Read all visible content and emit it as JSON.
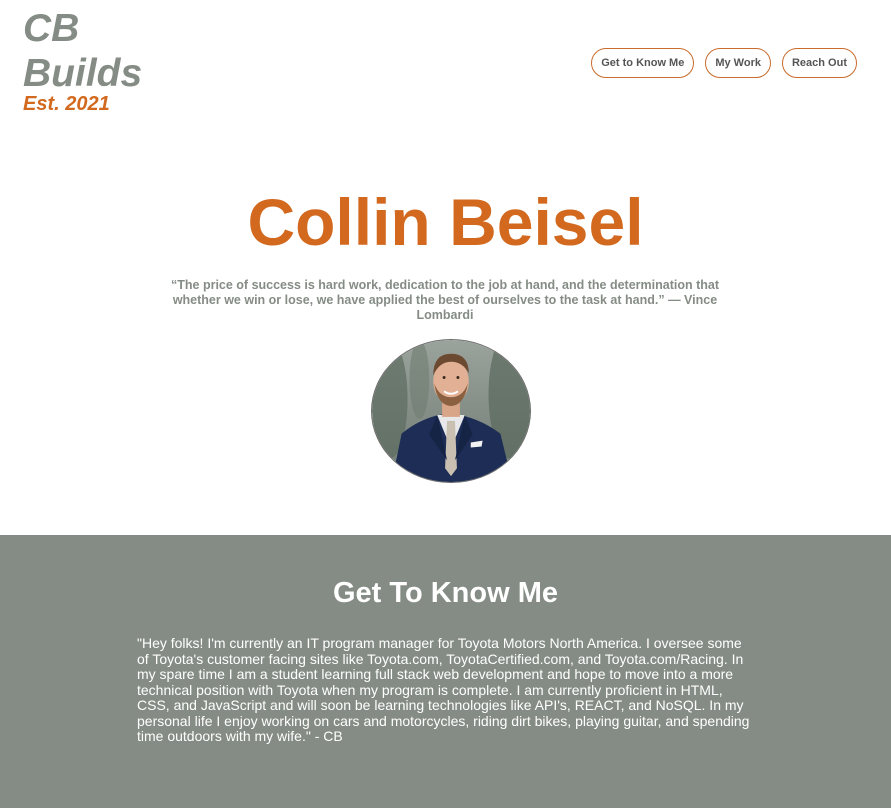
{
  "header": {
    "logo_line1": "CB",
    "logo_line2": "Builds",
    "logo_est": "Est. 2021",
    "nav": [
      {
        "label": "Get to Know Me"
      },
      {
        "label": "My Work"
      },
      {
        "label": "Reach Out"
      }
    ]
  },
  "hero": {
    "name": "Collin Beisel",
    "quote": "“The price of success is hard work, dedication to the job at hand, and the determination that whether we win or lose, we have applied the best of ourselves to the task at hand.” — Vince Lombardi"
  },
  "about": {
    "heading": "Get To Know Me",
    "body": "\"Hey folks! I'm currently an IT program manager for Toyota Motors North America. I oversee some of Toyota's customer facing sites like Toyota.com, ToyotaCertified.com, and Toyota.com/Racing. In my spare time I am a student learning full stack web development and hope to move into a more technical position with Toyota when my program is complete. I am currently proficient in HTML, CSS, and JavaScript and will soon be learning technologies like API's, REACT, and NoSQL. In my personal life I enjoy working on cars and motorcycles, riding dirt bikes, playing guitar, and spending time outdoors with my wife.\" - CB"
  },
  "colors": {
    "accent_orange": "#d2691e",
    "sage_gray": "#858c85",
    "white": "#ffffff"
  }
}
